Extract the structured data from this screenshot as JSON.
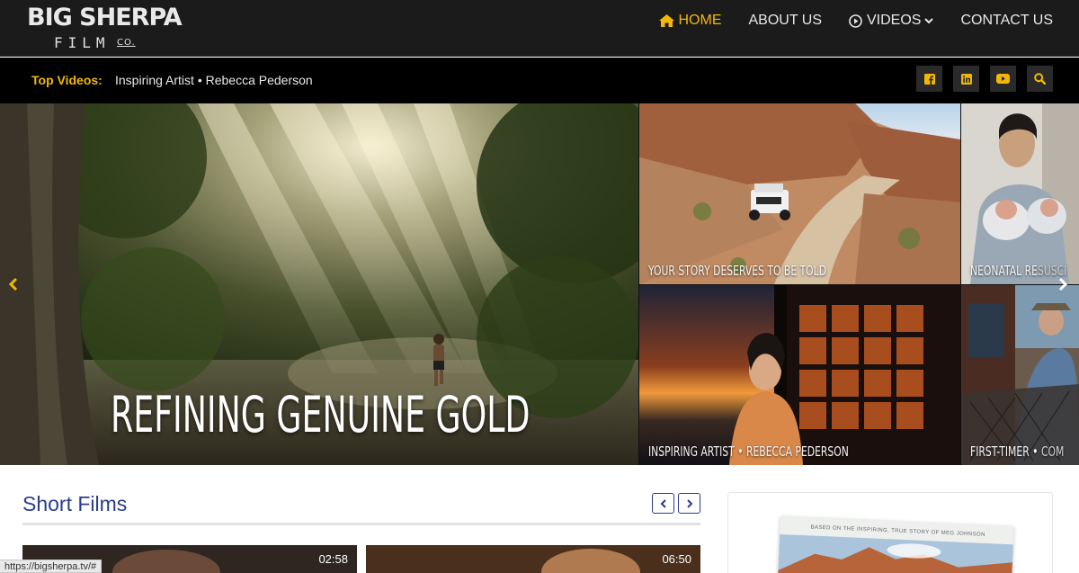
{
  "brand": {
    "line1": "BIG SHERPA",
    "line2": "FILM",
    "line3": "CO."
  },
  "nav": {
    "items": [
      {
        "label": "HOME",
        "icon": "home-icon",
        "active": true
      },
      {
        "label": "ABOUT US"
      },
      {
        "label": "VIDEOS",
        "icon": "play-circle-icon",
        "dropdown": true
      },
      {
        "label": "CONTACT US"
      }
    ]
  },
  "top_videos": {
    "label": "Top Videos:",
    "title": "Inspiring Artist • Rebecca Pederson",
    "social": [
      "facebook-icon",
      "linkedin-icon",
      "youtube-icon",
      "search-icon"
    ]
  },
  "hero": {
    "main": {
      "title": "REFINING GENUINE GOLD"
    },
    "tiles": [
      {
        "title": "YOUR STORY DESERVES TO BE TOLD",
        "dim": ""
      },
      {
        "title": "NEONATAL RE",
        "dim": "SUSCI"
      },
      {
        "title": "INSPIRING ARTIST • REBECCA PEDERSON",
        "dim": ""
      },
      {
        "title": "FIRST-TIMER • ",
        "dim": "COM"
      }
    ]
  },
  "short_films": {
    "title": "Short Films",
    "videos": [
      {
        "duration": "02:58"
      },
      {
        "duration": "06:50"
      }
    ]
  },
  "poster": {
    "tagline": "BASED ON THE INSPIRING, TRUE STORY OF MEG JOHNSON"
  },
  "status_url": "https://bigsherpa.tv/#",
  "colors": {
    "accent": "#f2b705",
    "section_title": "#283c8c",
    "navbar": "#1b1b1b"
  }
}
